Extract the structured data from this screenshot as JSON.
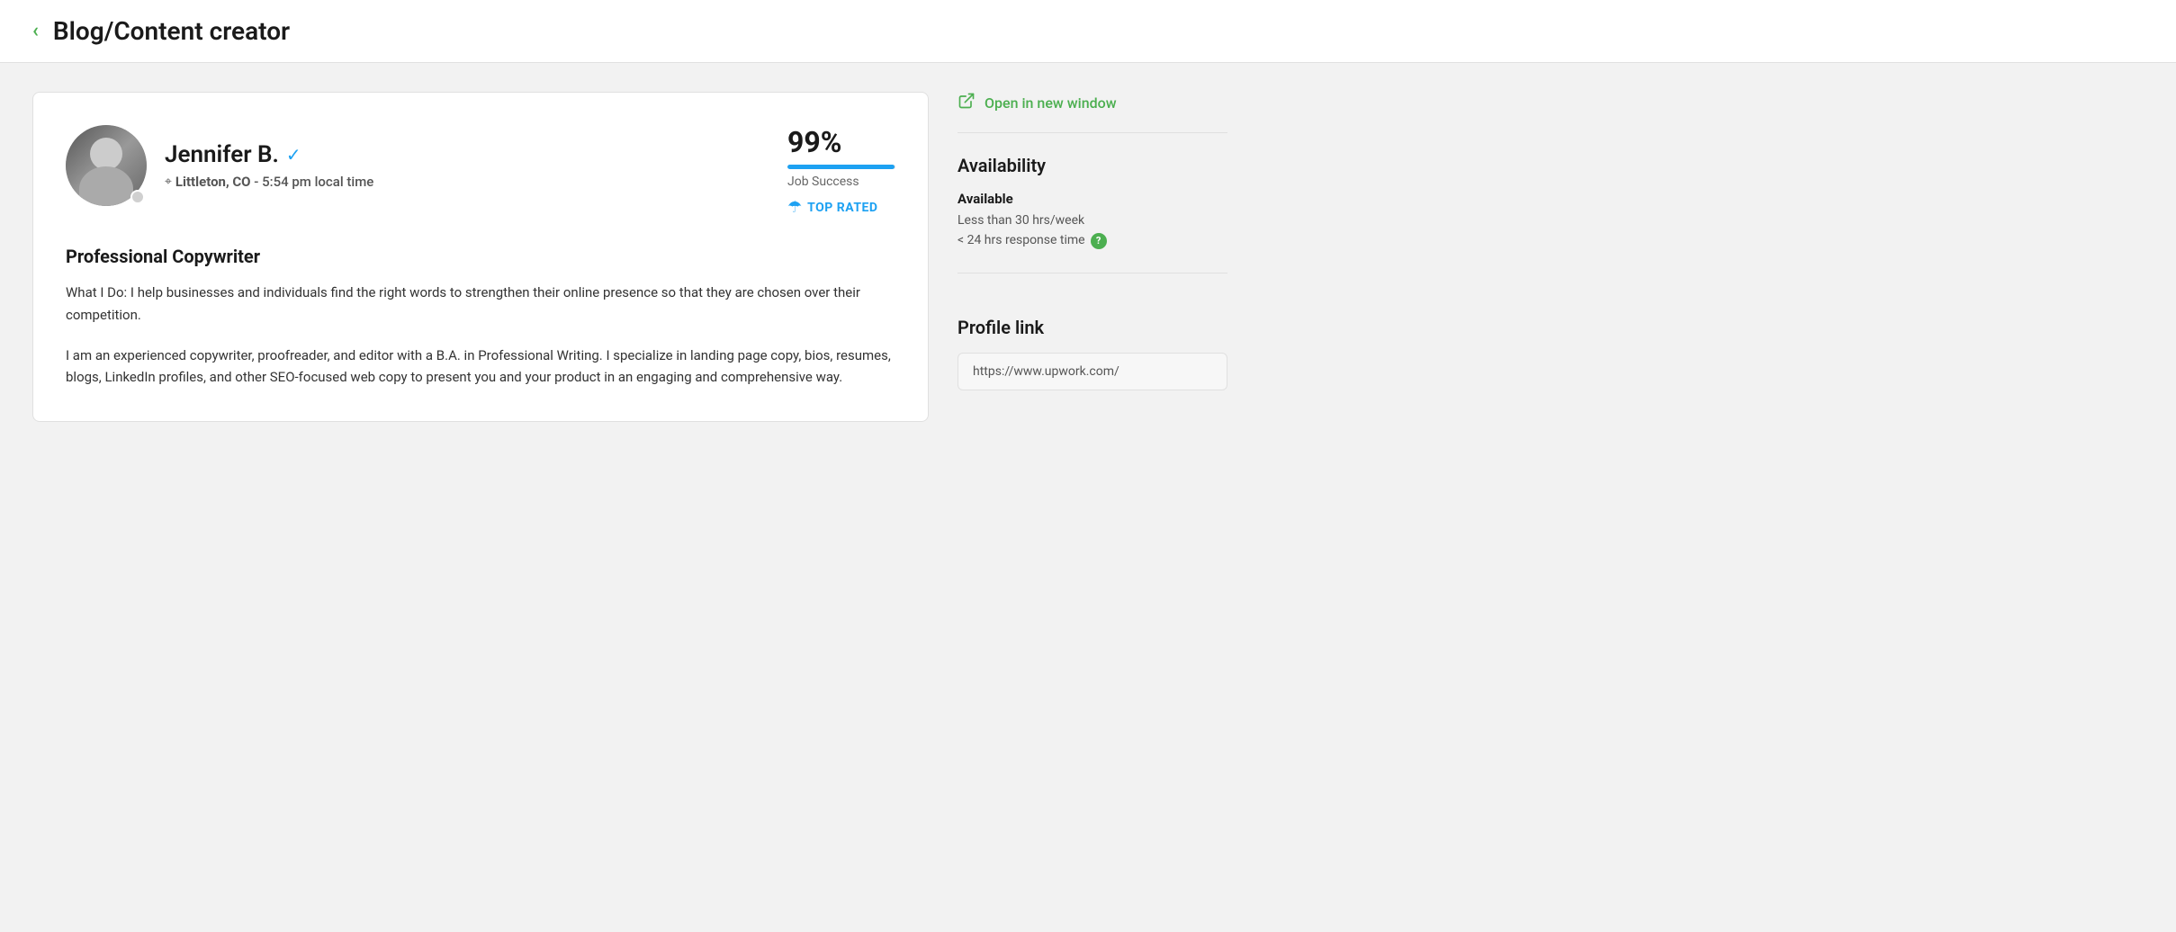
{
  "header": {
    "back_icon": "‹",
    "title": "Blog/Content creator"
  },
  "profile": {
    "name": "Jennifer B.",
    "verified": true,
    "location": "Littleton, CO",
    "local_time": "5:54 pm local time",
    "job_success_percent": "99%",
    "job_success_label": "Job Success",
    "progress_width": "99%",
    "top_rated_label": "TOP RATED",
    "headline": "Professional Copywriter",
    "bio_paragraph1": "What I Do: I help businesses and individuals find the right words to strengthen their online presence so that they are chosen over their competition.",
    "bio_paragraph2": "I am an experienced copywriter, proofreader, and editor with a B.A. in Professional Writing. I specialize in landing page copy, bios, resumes, blogs, LinkedIn profiles, and other SEO-focused web copy to present you and your product in an engaging and comprehensive way."
  },
  "sidebar": {
    "open_new_window_label": "Open in new window",
    "availability_title": "Availability",
    "availability_status": "Available",
    "availability_hours": "Less than 30 hrs/week",
    "response_time": "< 24 hrs response time",
    "profile_link_title": "Profile link",
    "profile_link_url": "https://www.upwork.com/"
  },
  "colors": {
    "green": "#4caf50",
    "blue": "#1da1f2",
    "dark": "#1a1a1a"
  }
}
